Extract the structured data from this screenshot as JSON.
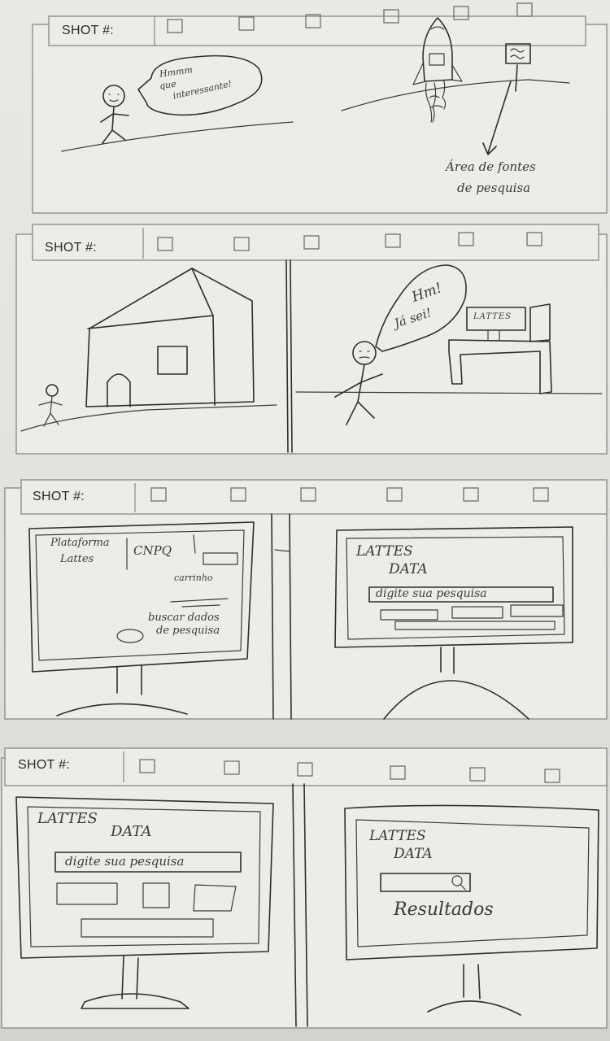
{
  "storyboard": {
    "rows": [
      {
        "label": "SHOT #:",
        "bubble_text": [
          "Hmmm",
          "que",
          "interessante!"
        ],
        "caption_lines": [
          "Área de fontes",
          "de pesquisa"
        ]
      },
      {
        "label": "SHOT #:",
        "bubble_text": [
          "Hm!",
          "Já sei!"
        ],
        "monitor_label": "LATTES"
      },
      {
        "label": "SHOT #:",
        "left_screen": {
          "title_lines": [
            "Plataforma",
            "Lattes"
          ],
          "org": "CNPQ",
          "notes": [
            "carrinho",
            "buscar dados",
            "de pesquisa"
          ]
        },
        "right_screen": {
          "title_lines": [
            "LATTES",
            "DATA"
          ],
          "search_text": "digite sua pesquisa"
        }
      },
      {
        "label": "SHOT #:",
        "left_screen": {
          "title_lines": [
            "LATTES",
            "DATA"
          ],
          "search_text": "digite sua pesquisa"
        },
        "right_screen": {
          "title_lines": [
            "LATTES",
            "DATA"
          ],
          "results_text": "Resultados"
        }
      }
    ]
  }
}
